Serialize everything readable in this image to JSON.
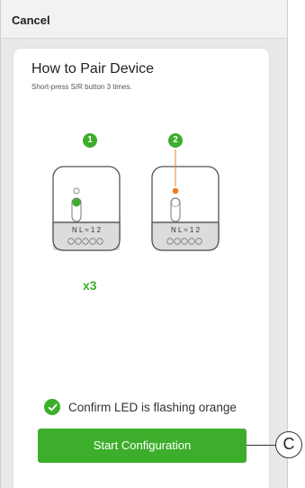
{
  "header": {
    "cancel_label": "Cancel"
  },
  "card": {
    "title": "How to Pair Device",
    "subtitle": "Short-press S/R button 3 times."
  },
  "steps": [
    {
      "number": "1",
      "terminal_labels": "N L ≈ 1 2",
      "led_color": "#3dae2b"
    },
    {
      "number": "2",
      "terminal_labels": "N L ≈ 1 2",
      "led_color": "#f07c1c"
    }
  ],
  "press_count": "x3",
  "confirm": {
    "text": "Confirm LED is flashing orange",
    "icon": "check-circle-icon"
  },
  "start_button_label": "Start Configuration",
  "callout": {
    "label": "C"
  },
  "colors": {
    "accent": "#3dae2b",
    "led_orange": "#f07c1c"
  }
}
